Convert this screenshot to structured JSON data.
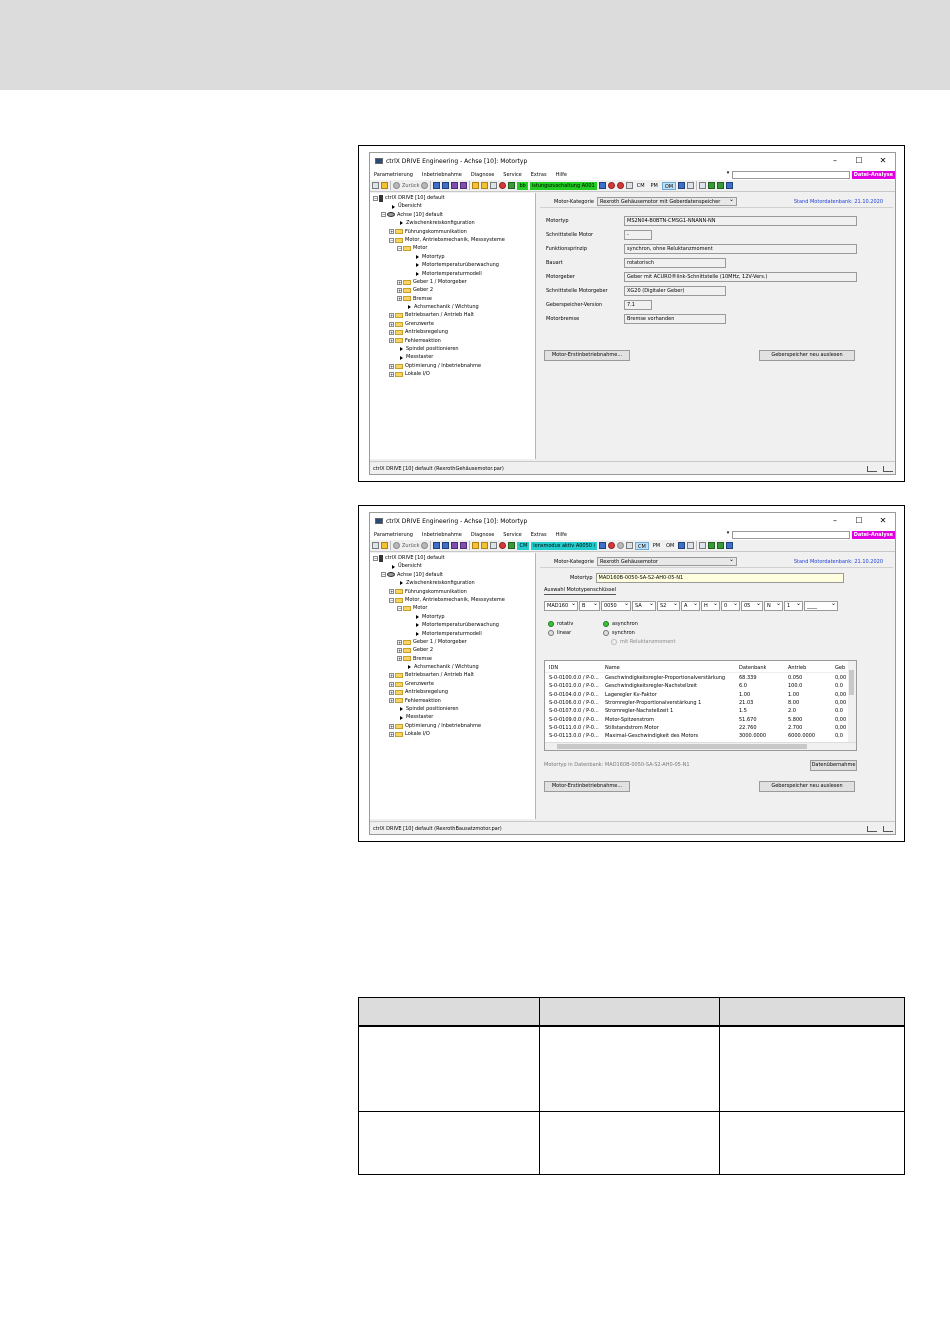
{
  "window": {
    "title": "ctrlX DRIVE Engineering - Achse [10]: Motortyp",
    "minimize": "–",
    "maximize": "☐",
    "close": "✕"
  },
  "menu": [
    "Parametrierung",
    "Inbetriebnahme",
    "Diagnose",
    "Service",
    "Extras",
    "Hilfe"
  ],
  "datei_analyse": "Datei-Analyse",
  "toolbar": {
    "back": "Zurück",
    "mode_ab": "AB",
    "mode_bb": "bb",
    "cm": "CM",
    "pm": "PM",
    "om": "OM",
    "status1": "istungszuschaltung  A001",
    "status2": "ionsmodus aktiv   A0050 i"
  },
  "tree": {
    "root": "ctrlX DRIVE [10] default",
    "uebersicht": "Übersicht",
    "achse": "Achse [10] default",
    "zwischenkreis": "Zwischenkreiskonfiguration",
    "fuehrung": "Führungskommunikation",
    "motor_achsmech": "Motor, Antriebsmechanik, Messsysteme",
    "motor": "Motor",
    "motortyp": "Motortyp",
    "temp_ueberwachung": "Motortemperaturüberwachung",
    "temp_modell": "Motortemperaturmodell",
    "geber1": "Geber 1 / Motorgeber",
    "geber2": "Geber 2",
    "bremse": "Bremse",
    "achsmechanik": "Achsmechanik / Wichtung",
    "betriebsarten": "Betriebsarten / Antrieb Halt",
    "grenzwerte": "Grenzwerte",
    "antriebsregelung": "Antriebsregelung",
    "fehlerreaktion": "Fehlerreaktion",
    "spindel": "Spindel positionieren",
    "messtaster": "Messtaster",
    "optimierung": "Optimierung / Inbetriebnahme",
    "lokale_io": "Lokale I/O"
  },
  "screen1": {
    "kategorie_label": "Motor-Kategorie",
    "kategorie_value": "Rexroth Gehäusemotor mit Geberdatenspeicher",
    "stand": "Stand Motordatenbank:  21.10.2020",
    "params": [
      {
        "label": "Motortyp",
        "value": "MS2N04-B0BTN-CMSG1-NNANN-NN"
      },
      {
        "label": "Schnittstelle Motor",
        "value": "-"
      },
      {
        "label": "Funktionsprinzip",
        "value": "synchron, ohne Reluktanzmoment"
      },
      {
        "label": "Bauart",
        "value": "rotatorisch"
      },
      {
        "label": "Motorgeber",
        "value": "Geber mit ACURO®link-Schnittstelle (10MHz, 12V-Vers.)"
      },
      {
        "label": "Schnittstelle Motorgeber",
        "value": "XG20 (Digitaler Geber)"
      },
      {
        "label": "Geberspeicher-Version",
        "value": "7.1"
      },
      {
        "label": "Motorbremse",
        "value": "Bremse vorhanden"
      }
    ],
    "btn_erstinbetriebnahme": "Motor-Erstinbetriebnahme...",
    "btn_geberspeicher": "Geberspeicher neu auslesen",
    "statusbar": "ctrlX DRIVE [10] default (RexrothGehäusemotor.par)"
  },
  "screen2": {
    "kategorie_label": "Motor-Kategorie",
    "kategorie_value": "Rexroth Gehäusemotor",
    "stand": "Stand Motordatenbank:  21.10.2020",
    "motortyp_label": "Motortyp",
    "motortyp_value": "MAD160B-0050-SA-S2-AH0-05-N1",
    "auswahl_link": "Auswahl Mototypenschlüssel",
    "key_fields": [
      "MAD160",
      "B",
      "0050",
      "SA",
      "S2",
      "A",
      "H",
      "0",
      "05",
      "N",
      "1",
      "____"
    ],
    "radio_rotativ": "rotativ",
    "radio_linear": "linear",
    "radio_asynchron": "asynchron",
    "radio_synchron": "synchron",
    "check_reluktanz": "mit Reluktanzmoment",
    "table_headers": [
      "IDN",
      "Name",
      "Datenbank",
      "Antrieb",
      "Geb"
    ],
    "table_rows": [
      [
        "S-0-0100.0.0 / P-0...",
        "Geschwindigkeitsregler-Proportionalverstärkung",
        "68.339",
        "0.050",
        "0,00"
      ],
      [
        "S-0-0101.0.0 / P-0...",
        "Geschwindigkeitsregler-Nachstellzeit",
        "6.0",
        "100.0",
        "0.0"
      ],
      [
        "S-0-0104.0.0 / P-0...",
        "Lageregler Kv-Faktor",
        "1.00",
        "1.00",
        "0,00"
      ],
      [
        "S-0-0106.0.0 / P-0...",
        "Stromregler-Proportionalverstärkung 1",
        "21.03",
        "8.00",
        "0,00"
      ],
      [
        "S-0-0107.0.0 / P-0...",
        "Stromregler-Nachstellzeit 1",
        "1.5",
        "2.0",
        "0.0"
      ],
      [
        "S-0-0109.0.0 / P-0...",
        "Motor-Spitzenstrom",
        "51.670",
        "5.800",
        "0,00"
      ],
      [
        "S-0-0111.0.0 / P-0...",
        "Stillstandstrom Motor",
        "22.760",
        "2.700",
        "0,00"
      ],
      [
        "S-0-0113.0.0 / P-0...",
        "Maximal-Geschwindigkeit des Motors",
        "3000.0000",
        "6000.0000",
        "0,0"
      ]
    ],
    "db_motortyp": "Motortyp in Datenbank:  MAD160B-0050-SA-S2-AH0-05-N1",
    "btn_datenuebernahme": "Datenübernahme",
    "btn_erstinbetriebnahme": "Motor-Erstinbetriebnahme...",
    "btn_geberspeicher": "Geberspeicher neu auslesen",
    "statusbar": "ctrlX DRIVE [10] default (RexrothBausatzmotor.par)"
  }
}
